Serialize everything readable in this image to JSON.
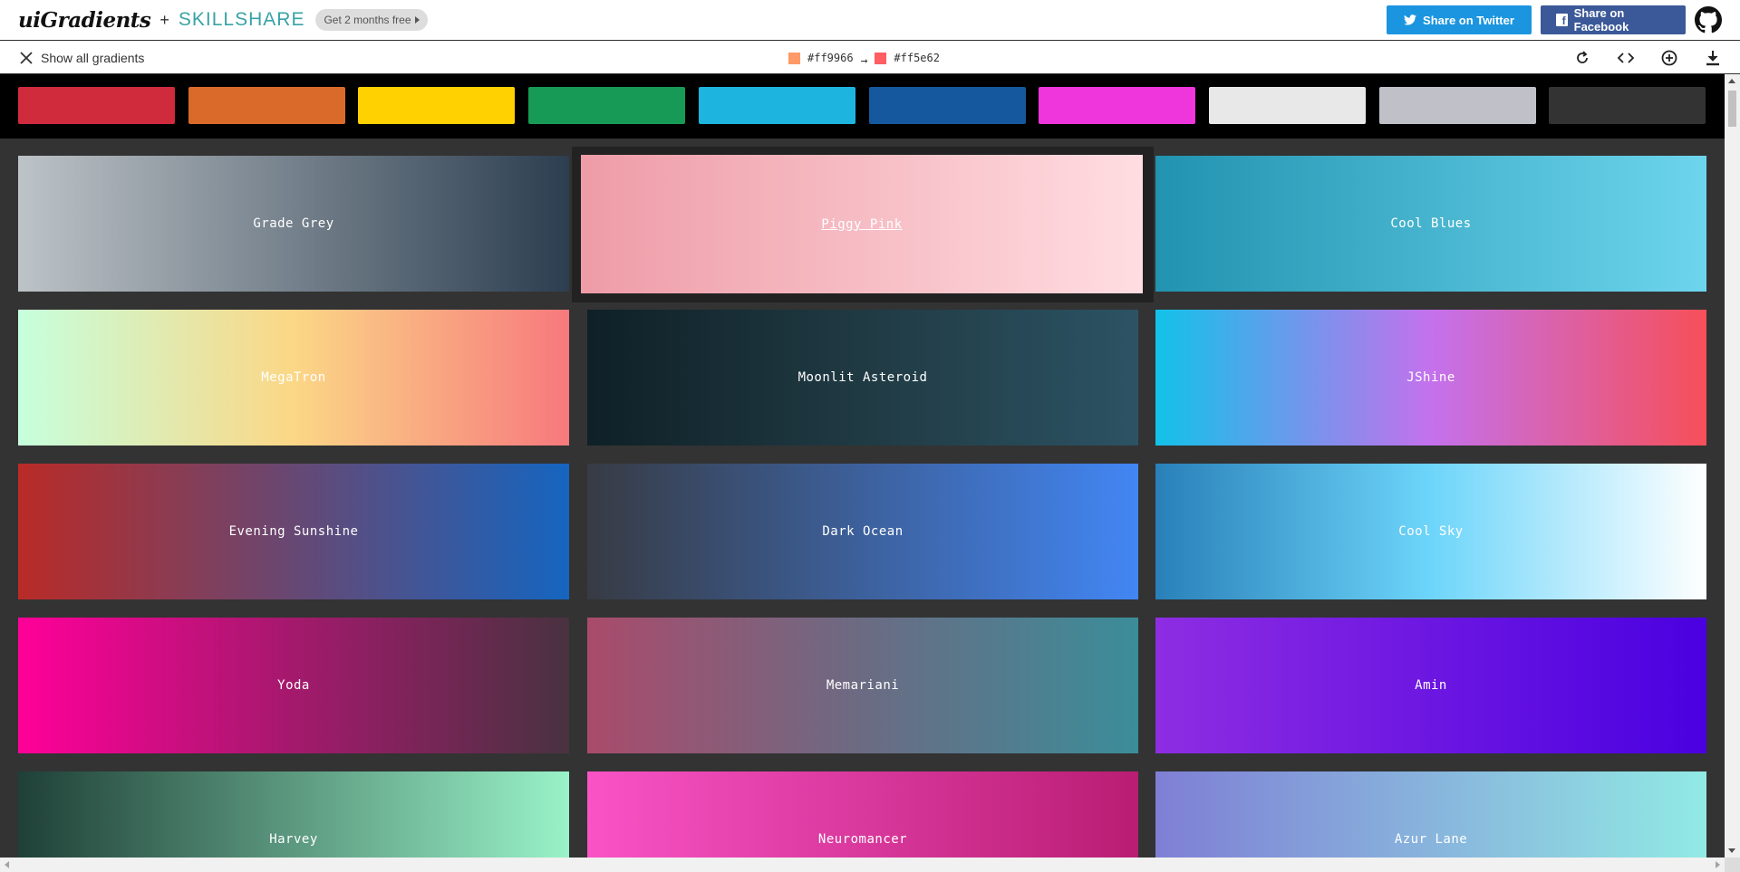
{
  "header": {
    "logo": "uiGradients",
    "plus": "+",
    "partner": "SKILLSHARE",
    "promo": "Get 2 months free",
    "twitter_label": "Share on Twitter",
    "facebook_label": "Share on Facebook"
  },
  "toolbar": {
    "show_all": "Show all gradients",
    "color_from": "#ff9966",
    "arrow": "→",
    "color_to": "#ff5e62"
  },
  "filters": [
    {
      "name": "red",
      "color": "#d02a3d"
    },
    {
      "name": "orange",
      "color": "#da6a29"
    },
    {
      "name": "yellow",
      "color": "#ffd100"
    },
    {
      "name": "green",
      "color": "#169a56"
    },
    {
      "name": "cyan",
      "color": "#1eb4e0"
    },
    {
      "name": "blue",
      "color": "#16589e"
    },
    {
      "name": "pink",
      "color": "#ef35dc"
    },
    {
      "name": "white",
      "color": "#e8e8e8"
    },
    {
      "name": "grey",
      "color": "#c0c0c8"
    },
    {
      "name": "black",
      "color": "#333333"
    }
  ],
  "gradients": [
    {
      "name": "Grade Grey",
      "from": "#bdc3c7",
      "to": "#2c3e50"
    },
    {
      "name": "Piggy Pink",
      "from": "#ee9ca7",
      "to": "#ffdde1"
    },
    {
      "name": "Cool Blues",
      "from": "#2193b0",
      "to": "#6dd5ed"
    },
    {
      "name": "MegaTron",
      "stops": "#c6ffdd, #fbd786, #f7797d"
    },
    {
      "name": "Moonlit Asteroid",
      "stops": "#0f2027, #203a43, #2c5364"
    },
    {
      "name": "JShine",
      "stops": "#12c2e9, #c471ed, #f64f59"
    },
    {
      "name": "Evening Sunshine",
      "from": "#b92b27",
      "to": "#1565c0"
    },
    {
      "name": "Dark Ocean",
      "from": "#373b44",
      "to": "#4286f4"
    },
    {
      "name": "Cool Sky",
      "stops": "#2980b9, #6dd5fa, #ffffff"
    },
    {
      "name": "Yoda",
      "from": "#ff0099",
      "to": "#493240"
    },
    {
      "name": "Memariani",
      "stops": "#aa4b6b, #6b6b83, #3b8d99"
    },
    {
      "name": "Amin",
      "from": "#8e2de2",
      "to": "#4a00e0"
    },
    {
      "name": "Harvey",
      "from": "#1f4037",
      "to": "#99f2c8"
    },
    {
      "name": "Neuromancer",
      "from": "#f953c6",
      "to": "#b91d73"
    },
    {
      "name": "Azur Lane",
      "from": "#7f7fd5",
      "to": "#91eae4"
    }
  ]
}
